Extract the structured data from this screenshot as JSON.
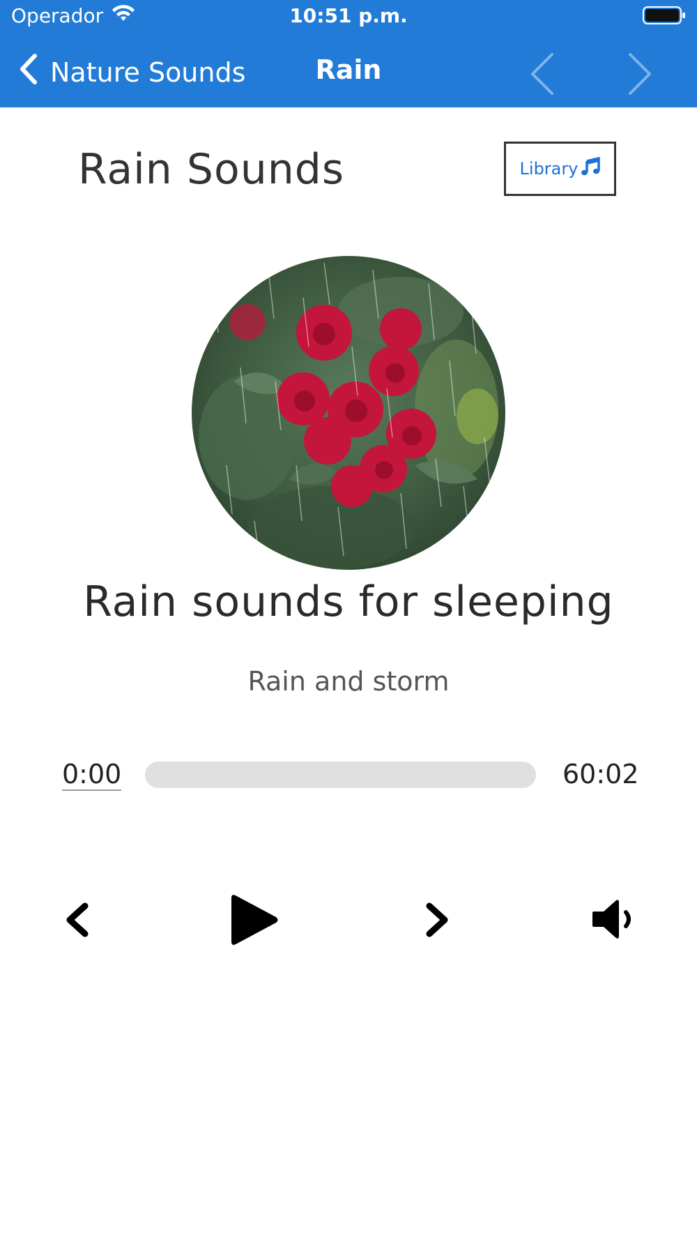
{
  "status_bar": {
    "carrier": "Operador",
    "time": "10:51 p.m.",
    "icons": {
      "wifi": "wifi-icon",
      "battery": "battery-icon"
    }
  },
  "nav": {
    "back_label": "Nature Sounds",
    "title": "Rain",
    "icons": {
      "back": "chevron-left-icon",
      "prev": "chevron-left-icon",
      "next": "chevron-right-icon"
    }
  },
  "header": {
    "title": "Rain Sounds",
    "library_label": "Library",
    "library_icon": "music-note-icon"
  },
  "track": {
    "artwork": "rain-roses-image",
    "title": "Rain sounds for sleeping",
    "subtitle": "Rain and storm"
  },
  "player": {
    "current_time": "0:00",
    "total_time": "60:02",
    "progress": 0,
    "controls": [
      "previous-icon",
      "play-icon",
      "next-icon",
      "volume-icon"
    ]
  },
  "colors": {
    "accent": "#227bd6",
    "link": "#1b72d6",
    "title_text": "#333333",
    "track_bg": "#e0e0e0"
  }
}
